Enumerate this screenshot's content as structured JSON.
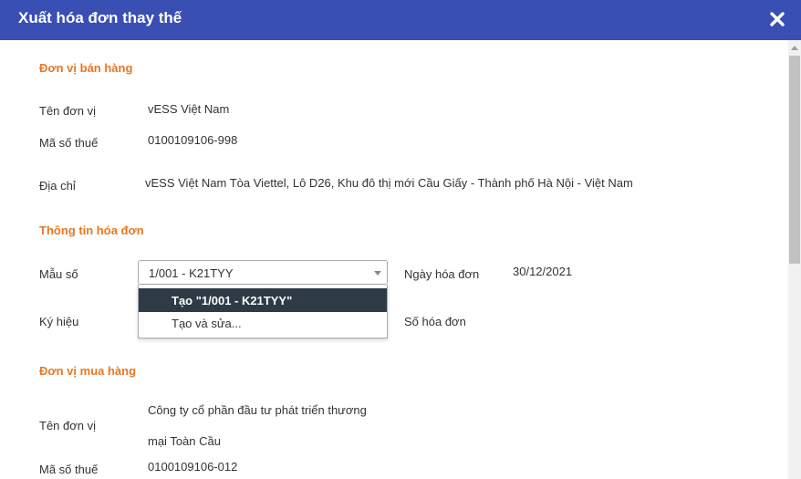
{
  "dialog": {
    "title": "Xuất hóa đơn thay thế"
  },
  "seller": {
    "section_title": "Đơn vị bán hàng",
    "name_label": "Tên đơn vị",
    "name_value": "vESS Việt Nam",
    "tax_label": "Mã số thuế",
    "tax_value": "0100109106-998",
    "address_label": "Địa chỉ",
    "address_value": "vESS Việt Nam Tòa Viettel, Lô D26, Khu đô thị mới Cầu Giấy - Thành phố Hà Nội - Việt Nam"
  },
  "invoice": {
    "section_title": "Thông tin hóa đơn",
    "template_label": "Mẫu số",
    "template_value": "1/001 - K21TYY",
    "template_options": [
      "Tạo \"1/001 - K21TYY\"",
      "Tạo và sửa..."
    ],
    "symbol_label": "Ký hiệu",
    "date_label": "Ngày hóa đơn",
    "date_value": "30/12/2021",
    "number_label": "Số hóa đơn"
  },
  "buyer": {
    "section_title": "Đơn vị mua hàng",
    "name_label": "Tên đơn vị",
    "name_line1": "Công ty cổ phần đầu tư phát triển thương",
    "name_line2": "mại Toàn Cầu",
    "tax_label": "Mã số thuế",
    "tax_value": "0100109106-012"
  },
  "colors": {
    "titlebar": "#3a4fb3",
    "section_accent": "#e87722",
    "highlight_option": "#2e3b47"
  },
  "icons": {
    "close": "close-icon",
    "dropdown": "chevron-down-icon"
  }
}
